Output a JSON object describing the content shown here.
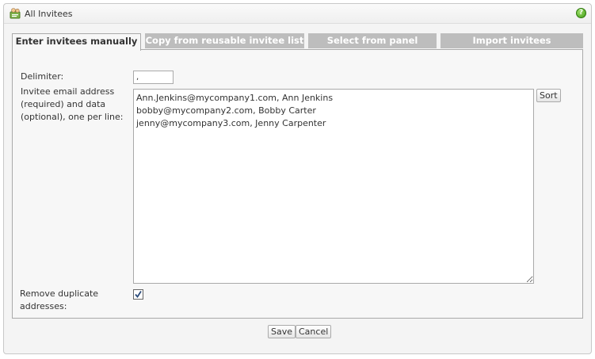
{
  "window": {
    "title": "All Invitees",
    "help_glyph": "?"
  },
  "tabs": [
    {
      "label": "Enter invitees manually",
      "active": true
    },
    {
      "label": "Copy from reusable invitee list",
      "active": false
    },
    {
      "label": "Select from panel",
      "active": false
    },
    {
      "label": "Import invitees",
      "active": false
    }
  ],
  "form": {
    "delimiter_label": "Delimiter:",
    "delimiter_value": ",",
    "emails_label": [
      "Invitee email address",
      "(required) and data",
      "(optional), one per line:"
    ],
    "emails_value": "Ann.Jenkins@mycompany1.com, Ann Jenkins\nbobby@mycompany2.com, Bobby Carter\njenny@mycompany3.com, Jenny Carpenter",
    "sort_label": "Sort",
    "remove_duplicates_label": [
      "Remove duplicate",
      "addresses:"
    ],
    "remove_duplicates_checked": true
  },
  "footer": {
    "save_label": "Save",
    "cancel_label": "Cancel"
  }
}
